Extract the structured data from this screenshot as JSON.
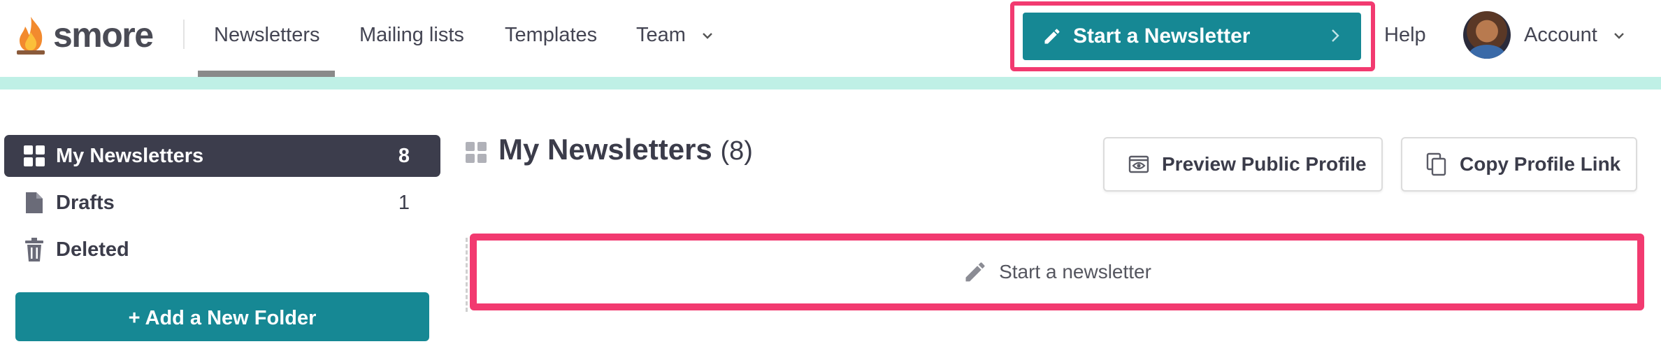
{
  "brand": {
    "name": "smore"
  },
  "nav": {
    "newsletters": "Newsletters",
    "mailing_lists": "Mailing lists",
    "templates": "Templates",
    "team": "Team"
  },
  "header": {
    "start_newsletter": "Start a Newsletter",
    "help": "Help",
    "account": "Account"
  },
  "sidebar": {
    "items": [
      {
        "label": "My Newsletters",
        "count": "8",
        "icon": "grid-icon"
      },
      {
        "label": "Drafts",
        "count": "1",
        "icon": "document-icon"
      },
      {
        "label": "Deleted",
        "count": "",
        "icon": "trash-icon"
      }
    ],
    "add_folder": "+ Add a New Folder"
  },
  "main": {
    "title": "My Newsletters",
    "count": "(8)",
    "preview_profile": "Preview Public Profile",
    "copy_link": "Copy Profile Link",
    "start_placeholder": "Start a newsletter"
  },
  "colors": {
    "teal": "#168894",
    "highlight": "#f23a70",
    "active_bg": "#3c3d4c",
    "strip": "#bff0e6"
  }
}
